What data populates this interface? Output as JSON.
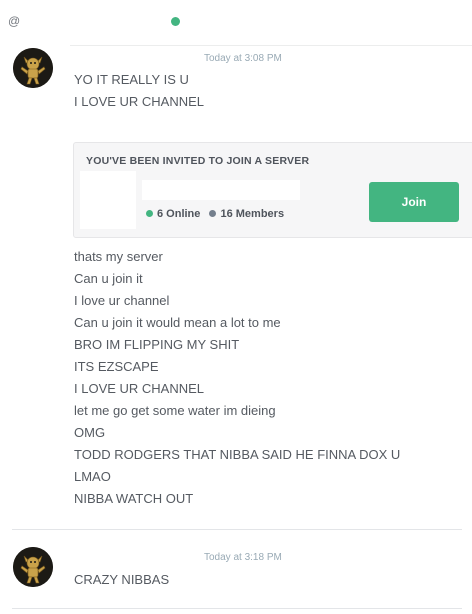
{
  "header": {
    "mention_prefix": "@",
    "status_color": "#43b581"
  },
  "messages": [
    {
      "timestamp": "Today at 3:08 PM",
      "avatar_icon": "bot-avatar-icon",
      "lines_before_invite": [
        "YO IT REALLY IS U",
        "I LOVE UR CHANNEL"
      ],
      "invite": {
        "title": "YOU'VE BEEN INVITED TO JOIN A SERVER",
        "online": "6 Online",
        "members": "16 Members",
        "join_label": "Join"
      },
      "lines_after_invite": [
        "thats my server",
        "Can u join it",
        "I love ur channel",
        "Can u join it would mean a lot to me",
        "BRO IM FLIPPING MY SHIT",
        "ITS EZSCAPE",
        "I LOVE UR CHANNEL",
        "let me go get some water im dieing",
        "OMG",
        "TODD RODGERS THAT NIBBA SAID HE FINNA DOX U",
        "LMAO",
        "NIBBA WATCH OUT"
      ]
    },
    {
      "timestamp": "Today at 3:18 PM",
      "avatar_icon": "bot-avatar-icon",
      "lines": [
        "CRAZY NIBBAS"
      ]
    }
  ],
  "colors": {
    "online": "#43b581",
    "members": "#747f8d",
    "join_button": "#43b581"
  }
}
